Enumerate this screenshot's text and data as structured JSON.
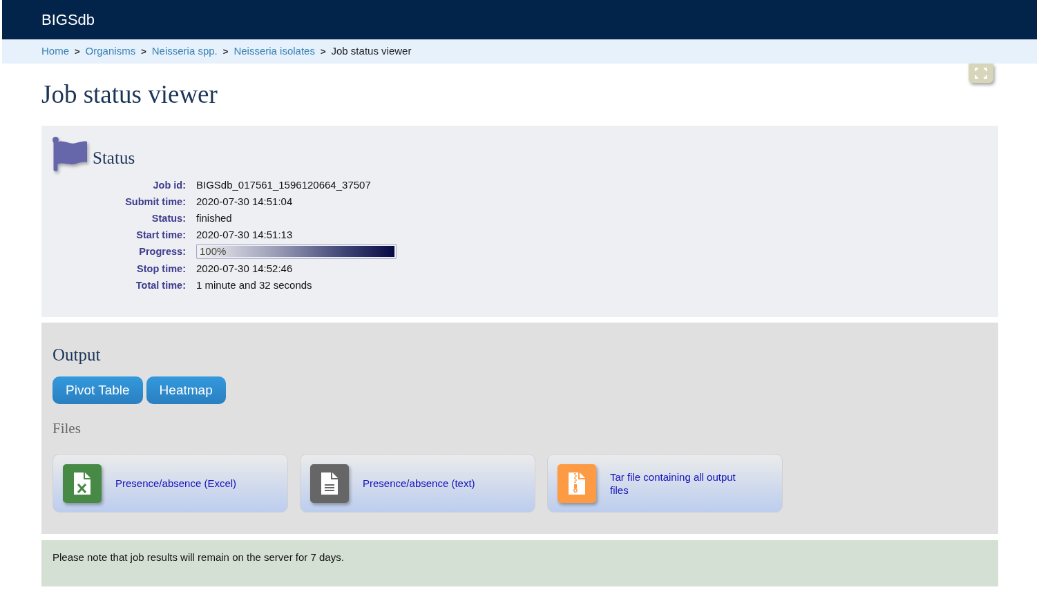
{
  "navbar": {
    "brand": "BIGSdb"
  },
  "breadcrumb": [
    {
      "label": "Home",
      "current": false
    },
    {
      "separator": ">",
      "label": "Organisms",
      "current": false
    },
    {
      "separator": ">",
      "label": "Neisseria spp.",
      "current": false
    },
    {
      "separator": ">",
      "label": "Neisseria isolates",
      "current": false
    },
    {
      "separator": ">",
      "label": "Job status viewer",
      "current": true
    }
  ],
  "page_title": "Job status viewer",
  "status": {
    "title": "Status",
    "fields": [
      {
        "kind": "text",
        "label": "Job id:",
        "value": "BIGSdb_017561_1596120664_37507"
      },
      {
        "kind": "text",
        "label": "Submit time:",
        "value": "2020-07-30 14:51:04"
      },
      {
        "kind": "text",
        "label": "Status:",
        "value": "finished"
      },
      {
        "kind": "text",
        "label": "Start time:",
        "value": "2020-07-30 14:51:13"
      },
      {
        "kind": "progress",
        "label": "Progress:",
        "level": 1,
        "reading": "100%"
      },
      {
        "kind": "text",
        "label": "Stop time:",
        "value": "2020-07-30 14:52:46"
      },
      {
        "kind": "text",
        "label": "Total time:",
        "value": "1 minute and 32 seconds"
      }
    ]
  },
  "output": {
    "title": "Output",
    "buttons": [
      {
        "label": "Pivot Table"
      },
      {
        "label": "Heatmap"
      }
    ],
    "files_title": "Files",
    "files": [
      {
        "kind": "excel",
        "label": "Presence/absence (Excel)"
      },
      {
        "kind": "text",
        "label": "Presence/absence (text)"
      },
      {
        "kind": "archive",
        "label": "Tar file containing all output files"
      }
    ]
  },
  "notice": "Please note that job results will remain on the server for 7 days."
}
